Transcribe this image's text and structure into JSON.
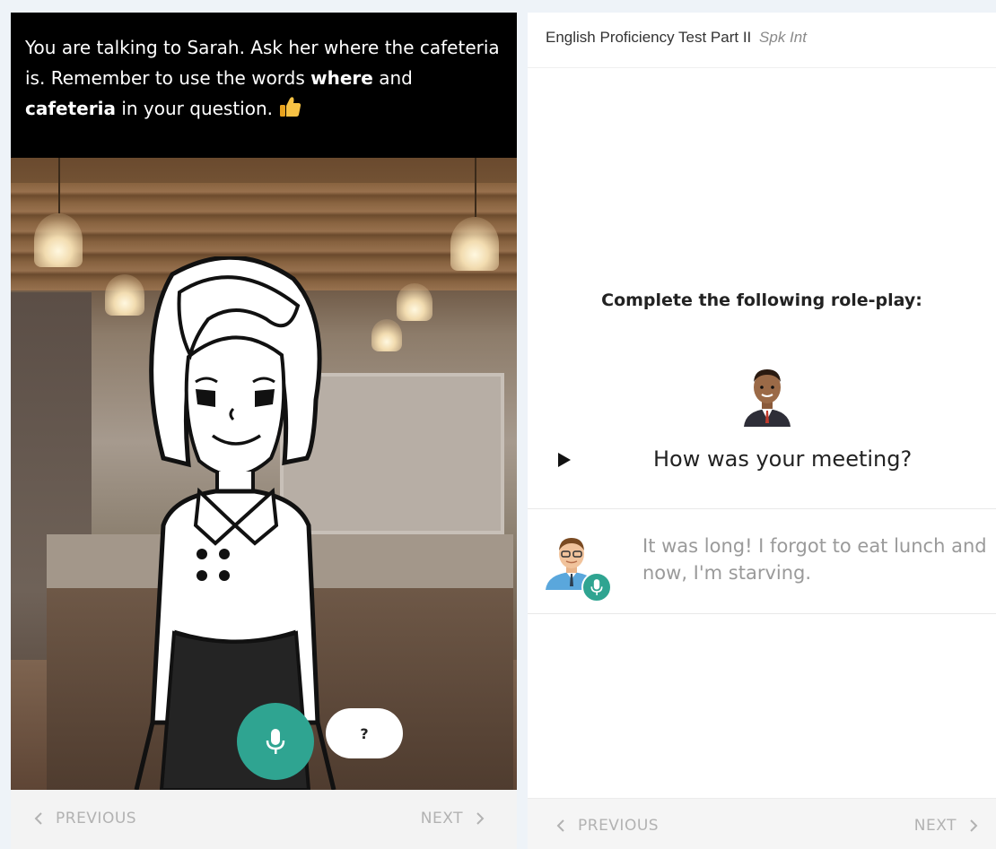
{
  "left_panel": {
    "prompt": {
      "part1": "You are talking to Sarah. Ask her where the cafeteria is. Remember to use the words ",
      "bold1": "where",
      "part2": " and ",
      "bold2": "cafeteria",
      "part3": " in your question. "
    },
    "help_label": "?",
    "nav": {
      "previous": "PREVIOUS",
      "next": "NEXT"
    }
  },
  "right_panel": {
    "header": {
      "title": "English Proficiency Test Part II",
      "subtitle": "Spk Int"
    },
    "task_title": "Complete the following role-play:",
    "question": "How was your meeting?",
    "answer": "It was long! I forgot to eat lunch and now, I'm starving.",
    "nav": {
      "previous": "PREVIOUS",
      "next": "NEXT"
    }
  },
  "colors": {
    "accent": "#2fa491",
    "prompt_bg": "#000000",
    "nav_text": "#b2b2b2"
  },
  "icons": [
    "thumbs-up-icon",
    "microphone-icon",
    "play-icon",
    "chevron-left-icon",
    "chevron-right-icon"
  ]
}
